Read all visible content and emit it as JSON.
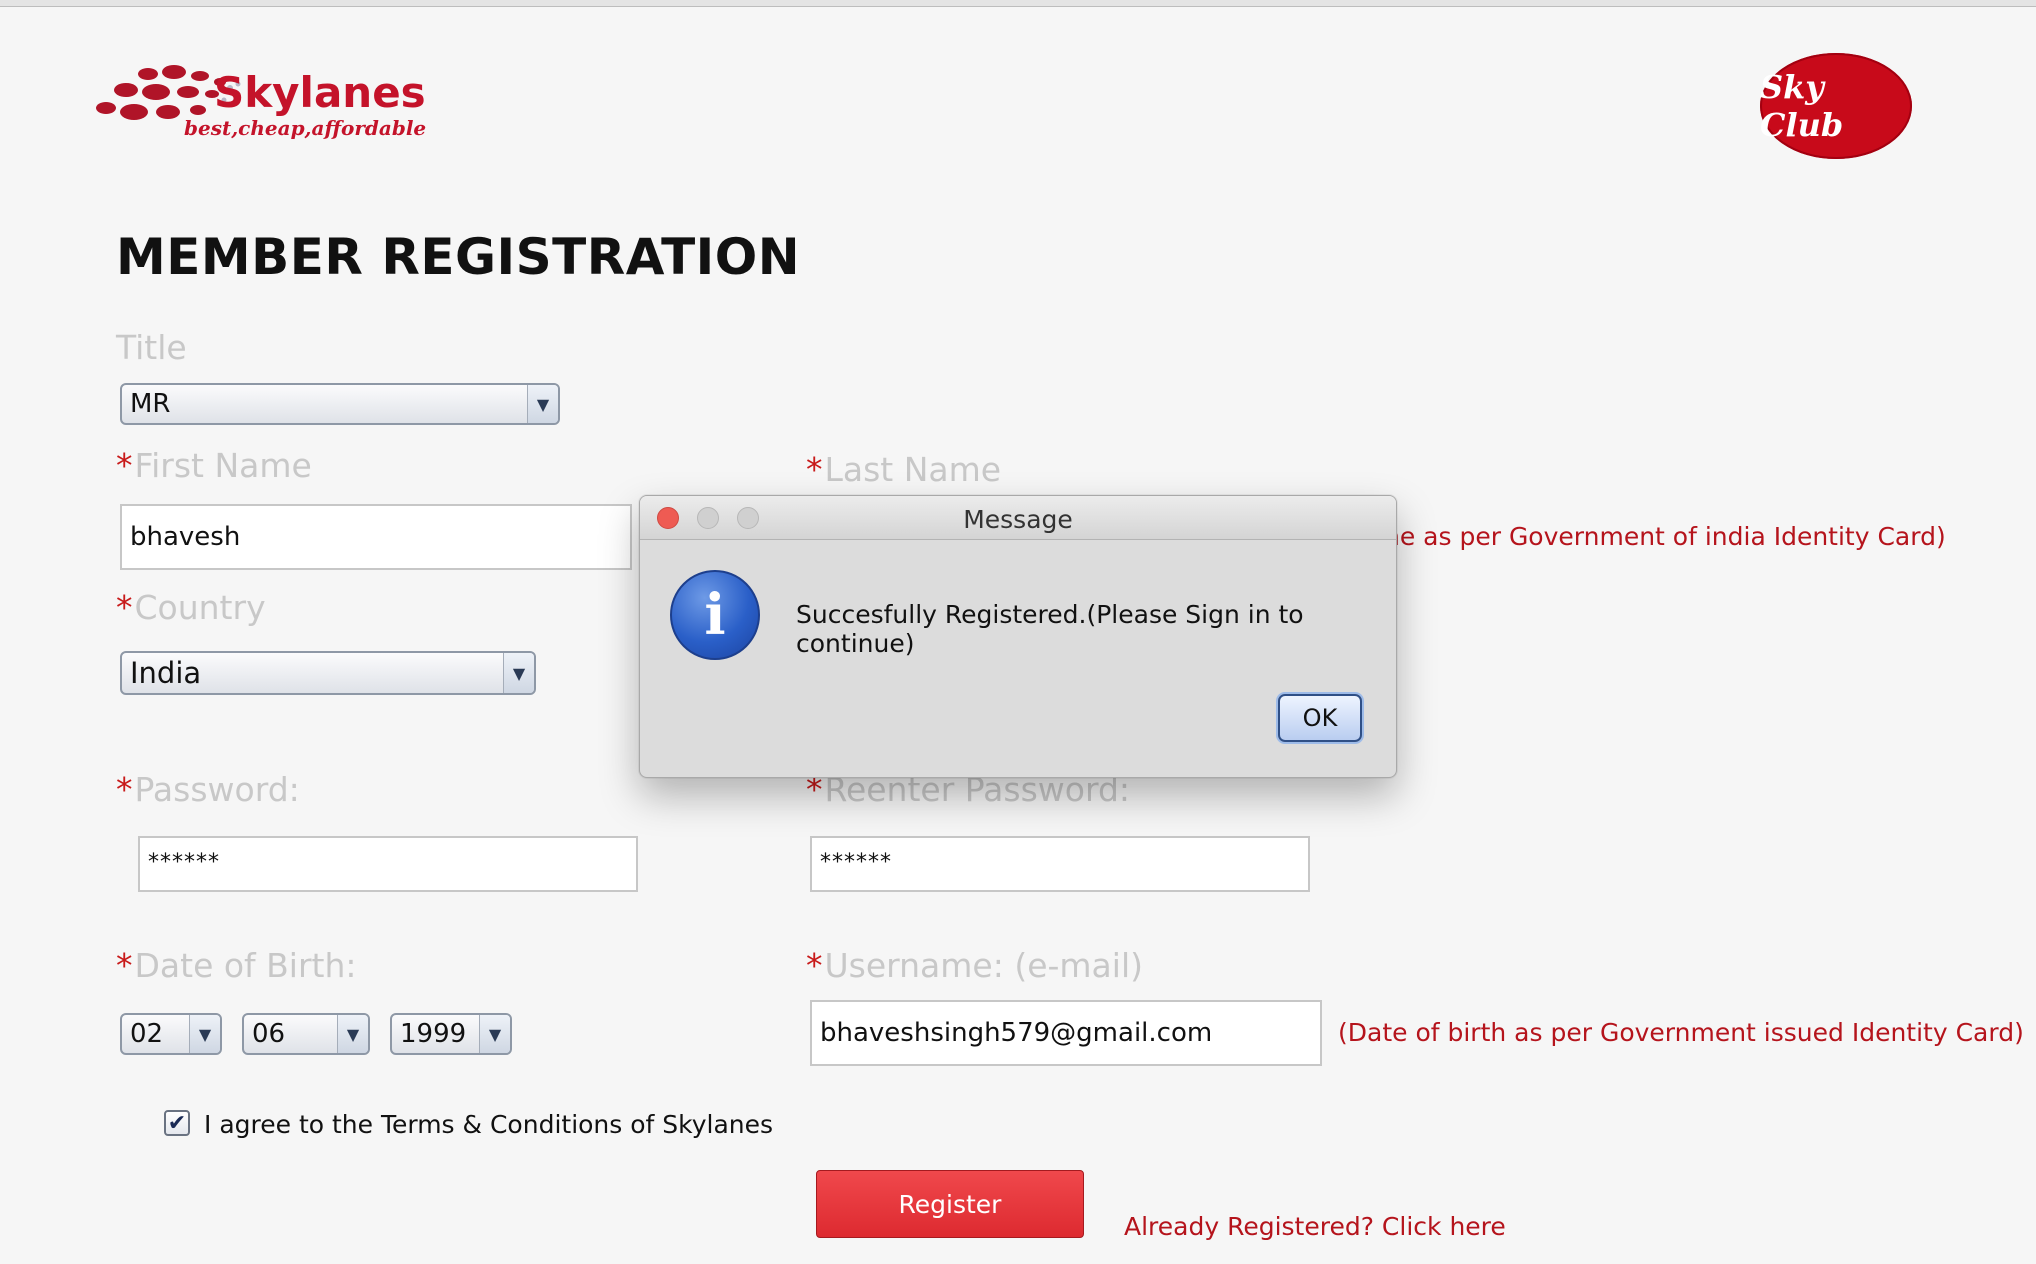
{
  "logo": {
    "brand": "Skylanes",
    "tagline": "best,cheap,affordable",
    "badge": "Sky Club"
  },
  "page": {
    "title": "MEMBER REGISTRATION"
  },
  "form": {
    "required_mark": "*",
    "title_label": "Title",
    "title_value": "MR",
    "first_name_label": "First Name",
    "first_name_value": "bhavesh",
    "last_name_label": "Last Name",
    "last_name_note": "ne as per Government of india Identity Card)",
    "country_label": "Country",
    "country_value": "India",
    "password_label": "Password:",
    "password_value": "******",
    "reenter_label": "Reenter Password:",
    "reenter_value": "******",
    "dob_label": "Date of Birth:",
    "dob_day": "02",
    "dob_month": "06",
    "dob_year": "1999",
    "username_label": "Username: (e-mail)",
    "username_value": "bhaveshsingh579@gmail.com",
    "dob_note": "(Date of birth as per Government issued Identity Card)",
    "terms_checked": true,
    "terms_label": "I agree to the Terms & Conditions of Skylanes",
    "register_label": "Register",
    "already_link": "Already Registered? Click here"
  },
  "dialog": {
    "title": "Message",
    "message": "Succesfully Registered.(Please Sign in to continue)",
    "ok_label": "OK",
    "icon": "info-icon"
  },
  "icons": {
    "combo_arrow": "▼",
    "check": "✔",
    "info": "i"
  },
  "colors": {
    "accent_red": "#c80a1a",
    "note_red": "#b5141c",
    "label_gray": "#c8c8c8"
  }
}
